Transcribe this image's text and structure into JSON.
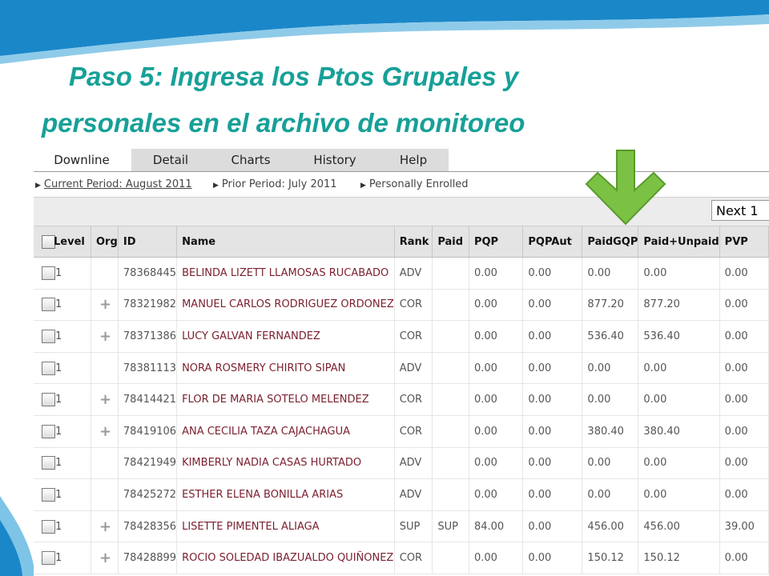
{
  "slide": {
    "title_line1": "Paso 5: Ingresa los Ptos Grupales y",
    "title_line2": "personales en el archivo de monitoreo"
  },
  "tabs": [
    {
      "label": "Downline",
      "active": true
    },
    {
      "label": "Detail",
      "active": false
    },
    {
      "label": "Charts",
      "active": false
    },
    {
      "label": "History",
      "active": false
    },
    {
      "label": "Help",
      "active": false
    }
  ],
  "breadcrumbs": [
    {
      "label": "Current Period: August 2011"
    },
    {
      "label": "Prior Period: July 2011"
    },
    {
      "label": "Personally Enrolled"
    }
  ],
  "pager": {
    "selected": "Next 1"
  },
  "table": {
    "columns": [
      "Level",
      "Org",
      "ID",
      "Name",
      "Rank",
      "Paid",
      "PQP",
      "PQPAut",
      "PaidGQP",
      "Paid+Unpaid",
      "PVP"
    ],
    "rows": [
      {
        "level": "1",
        "org": "",
        "id": "78368445",
        "name": "BELINDA LIZETT LLAMOSAS RUCABADO",
        "rank": "ADV",
        "paid": "",
        "pqp": "0.00",
        "pqpaut": "0.00",
        "paidgqp": "0.00",
        "paidunpaid": "0.00",
        "pvp": "0.00"
      },
      {
        "level": "1",
        "org": "+",
        "id": "78321982",
        "name": "MANUEL CARLOS RODRIGUEZ ORDONEZ",
        "rank": "COR",
        "paid": "",
        "pqp": "0.00",
        "pqpaut": "0.00",
        "paidgqp": "877.20",
        "paidunpaid": "877.20",
        "pvp": "0.00"
      },
      {
        "level": "1",
        "org": "+",
        "id": "78371386",
        "name": "LUCY GALVAN FERNANDEZ",
        "rank": "COR",
        "paid": "",
        "pqp": "0.00",
        "pqpaut": "0.00",
        "paidgqp": "536.40",
        "paidunpaid": "536.40",
        "pvp": "0.00"
      },
      {
        "level": "1",
        "org": "",
        "id": "78381113",
        "name": "NORA ROSMERY CHIRITO SIPAN",
        "rank": "ADV",
        "paid": "",
        "pqp": "0.00",
        "pqpaut": "0.00",
        "paidgqp": "0.00",
        "paidunpaid": "0.00",
        "pvp": "0.00"
      },
      {
        "level": "1",
        "org": "+",
        "id": "78414421",
        "name": "FLOR DE MARIA SOTELO MELENDEZ",
        "rank": "COR",
        "paid": "",
        "pqp": "0.00",
        "pqpaut": "0.00",
        "paidgqp": "0.00",
        "paidunpaid": "0.00",
        "pvp": "0.00"
      },
      {
        "level": "1",
        "org": "+",
        "id": "78419106",
        "name": "ANA CECILIA TAZA CAJACHAGUA",
        "rank": "COR",
        "paid": "",
        "pqp": "0.00",
        "pqpaut": "0.00",
        "paidgqp": "380.40",
        "paidunpaid": "380.40",
        "pvp": "0.00"
      },
      {
        "level": "1",
        "org": "",
        "id": "78421949",
        "name": "KIMBERLY NADIA CASAS HURTADO",
        "rank": "ADV",
        "paid": "",
        "pqp": "0.00",
        "pqpaut": "0.00",
        "paidgqp": "0.00",
        "paidunpaid": "0.00",
        "pvp": "0.00"
      },
      {
        "level": "1",
        "org": "",
        "id": "78425272",
        "name": "ESTHER ELENA BONILLA ARIAS",
        "rank": "ADV",
        "paid": "",
        "pqp": "0.00",
        "pqpaut": "0.00",
        "paidgqp": "0.00",
        "paidunpaid": "0.00",
        "pvp": "0.00"
      },
      {
        "level": "1",
        "org": "+",
        "id": "78428356",
        "name": "LISETTE PIMENTEL ALIAGA",
        "rank": "SUP",
        "paid": "SUP",
        "pqp": "84.00",
        "pqpaut": "0.00",
        "paidgqp": "456.00",
        "paidunpaid": "456.00",
        "pvp": "39.00"
      },
      {
        "level": "1",
        "org": "+",
        "id": "78428899",
        "name": "ROCIO SOLEDAD IBAZUALDO QUIÑONEZ",
        "rank": "COR",
        "paid": "",
        "pqp": "0.00",
        "pqpaut": "0.00",
        "paidgqp": "150.12",
        "paidunpaid": "150.12",
        "pvp": "0.00"
      }
    ]
  },
  "colors": {
    "title": "#17a098",
    "header_wave": "#1a87c9",
    "highlight_arrow": "#7bc143",
    "name_text": "#7a1f2e"
  }
}
